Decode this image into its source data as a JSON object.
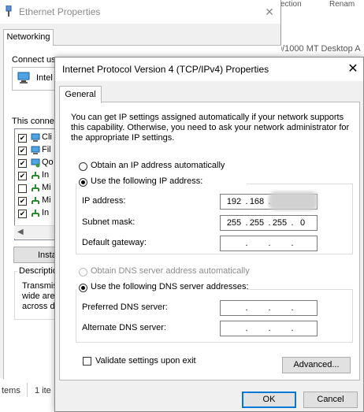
{
  "background": {
    "partial_right_text": "0/1000 MT Desktop A",
    "partial_col_1": "ection",
    "partial_col_2": "Renam",
    "status_items": "tems",
    "status_selected": "1 ite"
  },
  "ethernet_window": {
    "title": "Ethernet Properties",
    "tab": "Networking",
    "connect_using_label": "Connect us",
    "adapter_name": "Intel",
    "this_connection_label": "This conne",
    "items": [
      {
        "label": "Cli",
        "checked": true,
        "icon": "client-icon"
      },
      {
        "label": "Fil",
        "checked": true,
        "icon": "file-sharing-icon"
      },
      {
        "label": "Qo",
        "checked": true,
        "icon": "qos-icon"
      },
      {
        "label": "In",
        "checked": true,
        "icon": "protocol-icon"
      },
      {
        "label": "Mi",
        "checked": false,
        "icon": "protocol-icon"
      },
      {
        "label": "Mi",
        "checked": true,
        "icon": "protocol-icon"
      },
      {
        "label": "In",
        "checked": true,
        "icon": "protocol-icon"
      }
    ],
    "install_label": "Insta",
    "description_legend": "Descriptio",
    "description_text": [
      "Transmis",
      "wide are",
      "across d"
    ]
  },
  "dialog": {
    "title": "Internet Protocol Version 4 (TCP/IPv4) Properties",
    "tab": "General",
    "intro": "You can get IP settings assigned automatically if your network supports this capability. Otherwise, you need to ask your network administrator for the appropriate IP settings.",
    "obtain_ip_auto": "Obtain an IP address automatically",
    "use_following_ip": "Use the following IP address:",
    "ip_selection": "manual",
    "ip_address_label": "IP address:",
    "ip_address": [
      "192",
      "168",
      "",
      ""
    ],
    "subnet_mask_label": "Subnet mask:",
    "subnet_mask": [
      "255",
      "255",
      "255",
      "0"
    ],
    "default_gateway_label": "Default gateway:",
    "default_gateway": [
      "",
      "",
      "",
      ""
    ],
    "obtain_dns_auto": "Obtain DNS server address automatically",
    "use_following_dns": "Use the following DNS server addresses:",
    "dns_selection": "manual",
    "preferred_dns_label": "Preferred DNS server:",
    "preferred_dns": [
      "",
      "",
      "",
      ""
    ],
    "alternate_dns_label": "Alternate DNS server:",
    "alternate_dns": [
      "",
      "",
      "",
      ""
    ],
    "validate_label": "Validate settings upon exit",
    "validate_checked": false,
    "advanced_label": "Advanced...",
    "ok_label": "OK",
    "cancel_label": "Cancel",
    "close_glyph": "✕"
  }
}
